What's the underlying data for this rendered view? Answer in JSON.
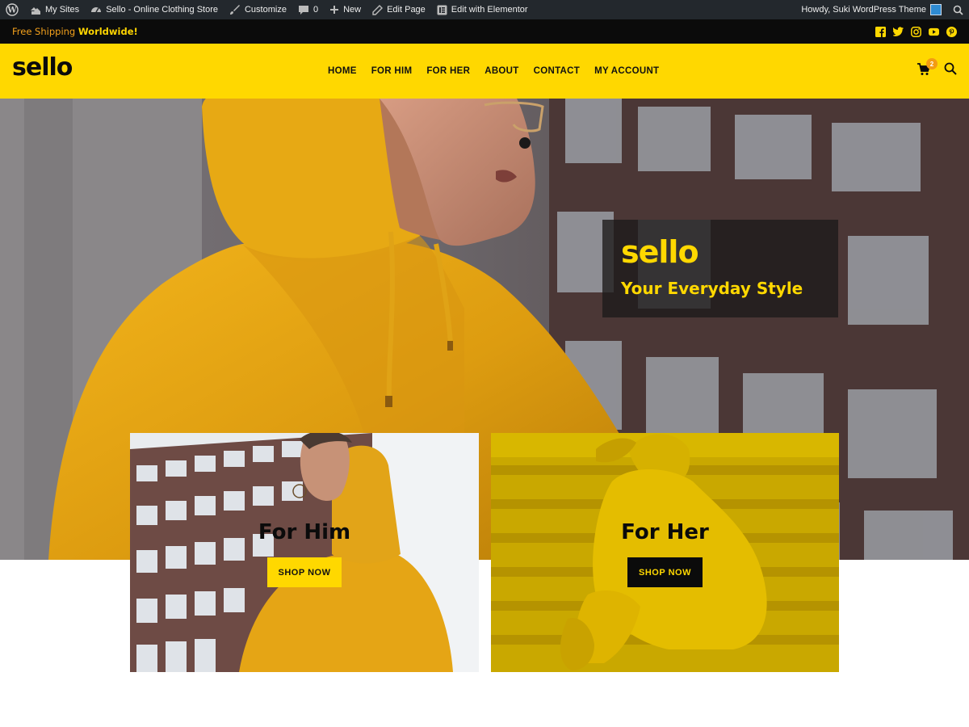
{
  "admin_bar": {
    "my_sites": "My Sites",
    "site_name": "Sello - Online Clothing Store",
    "customize": "Customize",
    "comments_count": "0",
    "new": "New",
    "edit_page": "Edit Page",
    "edit_elementor": "Edit with Elementor",
    "greeting": "Howdy, Suki WordPress Theme"
  },
  "topbar": {
    "promo_prefix": "Free Shipping ",
    "promo_bold": "Worldwide!",
    "socials": [
      "facebook-icon",
      "twitter-icon",
      "instagram-icon",
      "youtube-icon",
      "pinterest-icon"
    ]
  },
  "header": {
    "logo": "sello",
    "nav": [
      "HOME",
      "FOR HIM",
      "FOR HER",
      "ABOUT",
      "CONTACT",
      "MY ACCOUNT"
    ],
    "cart_count": "2"
  },
  "hero": {
    "title": "sello",
    "subtitle": "Your Everyday Style"
  },
  "cards": [
    {
      "title": "For Him",
      "button": "SHOP NOW"
    },
    {
      "title": "For Her",
      "button": "SHOP NOW"
    }
  ],
  "colors": {
    "brand_yellow": "#ffd800",
    "dark": "#0b0b0b",
    "accent_orange": "#f39c12"
  }
}
